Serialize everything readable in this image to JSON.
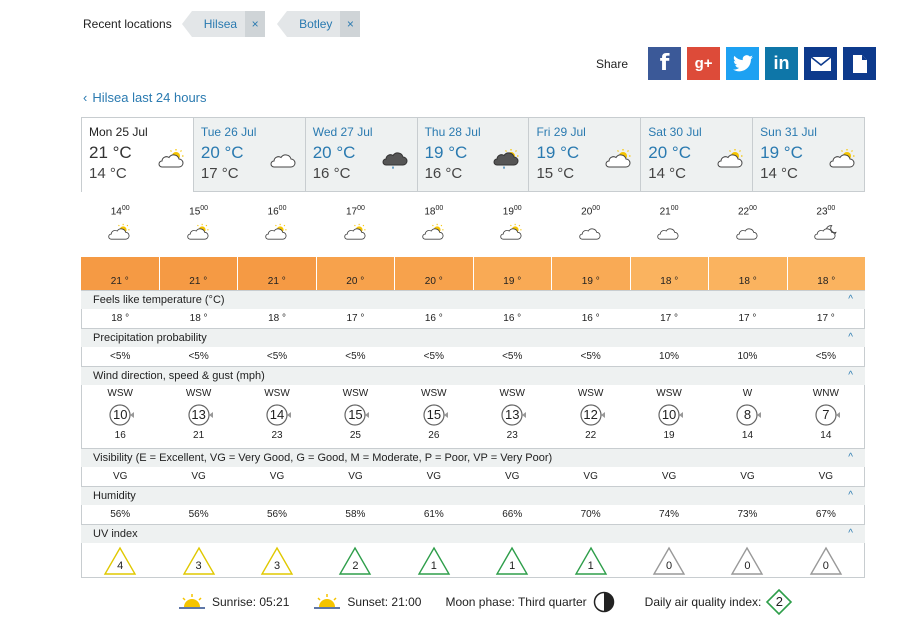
{
  "recent": {
    "label": "Recent locations",
    "locations": [
      {
        "name": "Hilsea",
        "remove": "×"
      },
      {
        "name": "Botley",
        "remove": "×"
      }
    ]
  },
  "share": {
    "label": "Share",
    "buttons": [
      {
        "name": "facebook",
        "color": "#3b5998",
        "glyph": "f"
      },
      {
        "name": "googleplus",
        "color": "#dd4b39",
        "glyph": "g+"
      },
      {
        "name": "twitter",
        "color": "#1da1f2",
        "glyph": ""
      },
      {
        "name": "linkedin",
        "color": "#0e76a8",
        "glyph": "in"
      },
      {
        "name": "email",
        "color": "#0d3a8c",
        "glyph": ""
      },
      {
        "name": "print",
        "color": "#0d3a8c",
        "glyph": ""
      }
    ]
  },
  "back_link": "Hilsea last 24 hours",
  "days": [
    {
      "name": "Mon 25 Jul",
      "max": "21 °C",
      "min": "14 °C",
      "icon": "sun-cloud",
      "active": true
    },
    {
      "name": "Tue 26 Jul",
      "max": "20 °C",
      "min": "17 °C",
      "icon": "cloud",
      "active": false
    },
    {
      "name": "Wed 27 Jul",
      "max": "20 °C",
      "min": "16 °C",
      "icon": "rain-cloud",
      "active": false
    },
    {
      "name": "Thu 28 Jul",
      "max": "19 °C",
      "min": "16 °C",
      "icon": "sun-rain-cloud",
      "active": false
    },
    {
      "name": "Fri 29 Jul",
      "max": "19 °C",
      "min": "15 °C",
      "icon": "sun-cloud",
      "active": false
    },
    {
      "name": "Sat 30 Jul",
      "max": "20 °C",
      "min": "14 °C",
      "icon": "sun-cloud",
      "active": false
    },
    {
      "name": "Sun 31 Jul",
      "max": "19 °C",
      "min": "14 °C",
      "icon": "sun-cloud",
      "active": false
    }
  ],
  "hours": [
    {
      "h": "14",
      "m": "00",
      "icon": "sun-cloud",
      "temp": "21 °",
      "color": "#f59a44"
    },
    {
      "h": "15",
      "m": "00",
      "icon": "sun-cloud",
      "temp": "21 °",
      "color": "#f59a44"
    },
    {
      "h": "16",
      "m": "00",
      "icon": "sun-cloud",
      "temp": "21 °",
      "color": "#f59a44"
    },
    {
      "h": "17",
      "m": "00",
      "icon": "sun-cloud",
      "temp": "20 °",
      "color": "#f7a24c"
    },
    {
      "h": "18",
      "m": "00",
      "icon": "sun-cloud",
      "temp": "20 °",
      "color": "#f7a24c"
    },
    {
      "h": "19",
      "m": "00",
      "icon": "sun-cloud",
      "temp": "19 °",
      "color": "#f9aa55"
    },
    {
      "h": "20",
      "m": "00",
      "icon": "cloud",
      "temp": "19 °",
      "color": "#f9aa55"
    },
    {
      "h": "21",
      "m": "00",
      "icon": "cloud",
      "temp": "18 °",
      "color": "#fab35f"
    },
    {
      "h": "22",
      "m": "00",
      "icon": "cloud",
      "temp": "18 °",
      "color": "#fab35f"
    },
    {
      "h": "23",
      "m": "00",
      "icon": "moon-cloud",
      "temp": "18 °",
      "color": "#fab35f"
    }
  ],
  "sections": {
    "feels": "Feels like temperature (°C)",
    "precip": "Precipitation probability",
    "wind": "Wind direction, speed & gust (mph)",
    "visibility": "Visibility (E = Excellent, VG = Very Good, G = Good, M = Moderate, P = Poor, VP = Very Poor)",
    "humidity": "Humidity",
    "uv": "UV index",
    "caret": "^"
  },
  "feels": [
    "18 °",
    "18 °",
    "18 °",
    "17 °",
    "16 °",
    "16 °",
    "16 °",
    "17 °",
    "17 °",
    "17 °"
  ],
  "precip": [
    "<5%",
    "<5%",
    "<5%",
    "<5%",
    "<5%",
    "<5%",
    "<5%",
    "10%",
    "10%",
    "<5%"
  ],
  "wind": [
    {
      "dir": "WSW",
      "speed": "10",
      "gust": "16"
    },
    {
      "dir": "WSW",
      "speed": "13",
      "gust": "21"
    },
    {
      "dir": "WSW",
      "speed": "14",
      "gust": "23"
    },
    {
      "dir": "WSW",
      "speed": "15",
      "gust": "25"
    },
    {
      "dir": "WSW",
      "speed": "15",
      "gust": "26"
    },
    {
      "dir": "WSW",
      "speed": "13",
      "gust": "23"
    },
    {
      "dir": "WSW",
      "speed": "12",
      "gust": "22"
    },
    {
      "dir": "WSW",
      "speed": "10",
      "gust": "19"
    },
    {
      "dir": "W",
      "speed": "8",
      "gust": "14"
    },
    {
      "dir": "WNW",
      "speed": "7",
      "gust": "14"
    }
  ],
  "visibility": [
    "VG",
    "VG",
    "VG",
    "VG",
    "VG",
    "VG",
    "VG",
    "VG",
    "VG",
    "VG"
  ],
  "humidity": [
    "56%",
    "56%",
    "56%",
    "58%",
    "61%",
    "66%",
    "70%",
    "74%",
    "73%",
    "67%"
  ],
  "uv": [
    {
      "v": "4",
      "color": "#e0c800"
    },
    {
      "v": "3",
      "color": "#e0c800"
    },
    {
      "v": "3",
      "color": "#e0c800"
    },
    {
      "v": "2",
      "color": "#2e9e4a"
    },
    {
      "v": "1",
      "color": "#2e9e4a"
    },
    {
      "v": "1",
      "color": "#2e9e4a"
    },
    {
      "v": "1",
      "color": "#2e9e4a"
    },
    {
      "v": "0",
      "color": "#999999"
    },
    {
      "v": "0",
      "color": "#999999"
    },
    {
      "v": "0",
      "color": "#999999"
    }
  ],
  "footer": {
    "sunrise": "Sunrise: 05:21",
    "sunset": "Sunset: 21:00",
    "moon": "Moon phase: Third quarter",
    "aqi_label": "Daily air quality index:",
    "aqi_value": "2"
  }
}
